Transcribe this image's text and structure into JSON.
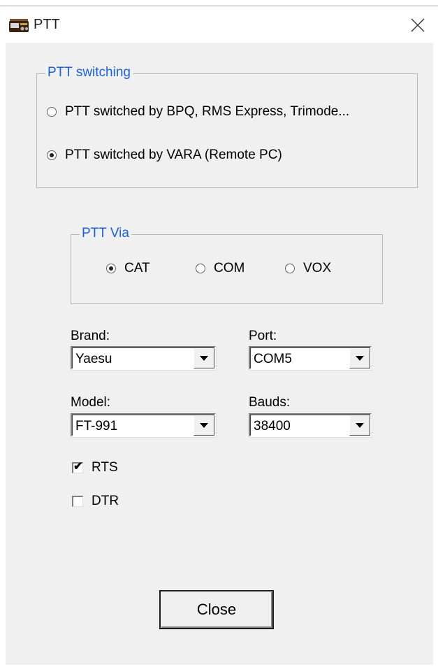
{
  "window": {
    "title": "PTT",
    "icons": {
      "app": "radio-app-icon",
      "close": "close-icon"
    }
  },
  "ptt_switching": {
    "legend": "PTT switching",
    "options": [
      {
        "label": "PTT switched by BPQ, RMS Express, Trimode...",
        "checked": false
      },
      {
        "label": "PTT switched by VARA (Remote PC)",
        "checked": true
      }
    ]
  },
  "ptt_via": {
    "legend": "PTT Via",
    "options": [
      {
        "label": "CAT",
        "checked": true
      },
      {
        "label": "COM",
        "checked": false
      },
      {
        "label": "VOX",
        "checked": false
      }
    ]
  },
  "brand": {
    "label": "Brand:",
    "value": "Yaesu"
  },
  "port": {
    "label": "Port:",
    "value": "COM5"
  },
  "model": {
    "label": "Model:",
    "value": "FT-991"
  },
  "bauds": {
    "label": "Bauds:",
    "value": "38400"
  },
  "rts": {
    "label": "RTS",
    "checked": true
  },
  "dtr": {
    "label": "DTR",
    "checked": false
  },
  "close_button": {
    "label": "Close"
  },
  "colors": {
    "legend": "#1a5fd6",
    "client_bg": "#f0f0f0"
  }
}
